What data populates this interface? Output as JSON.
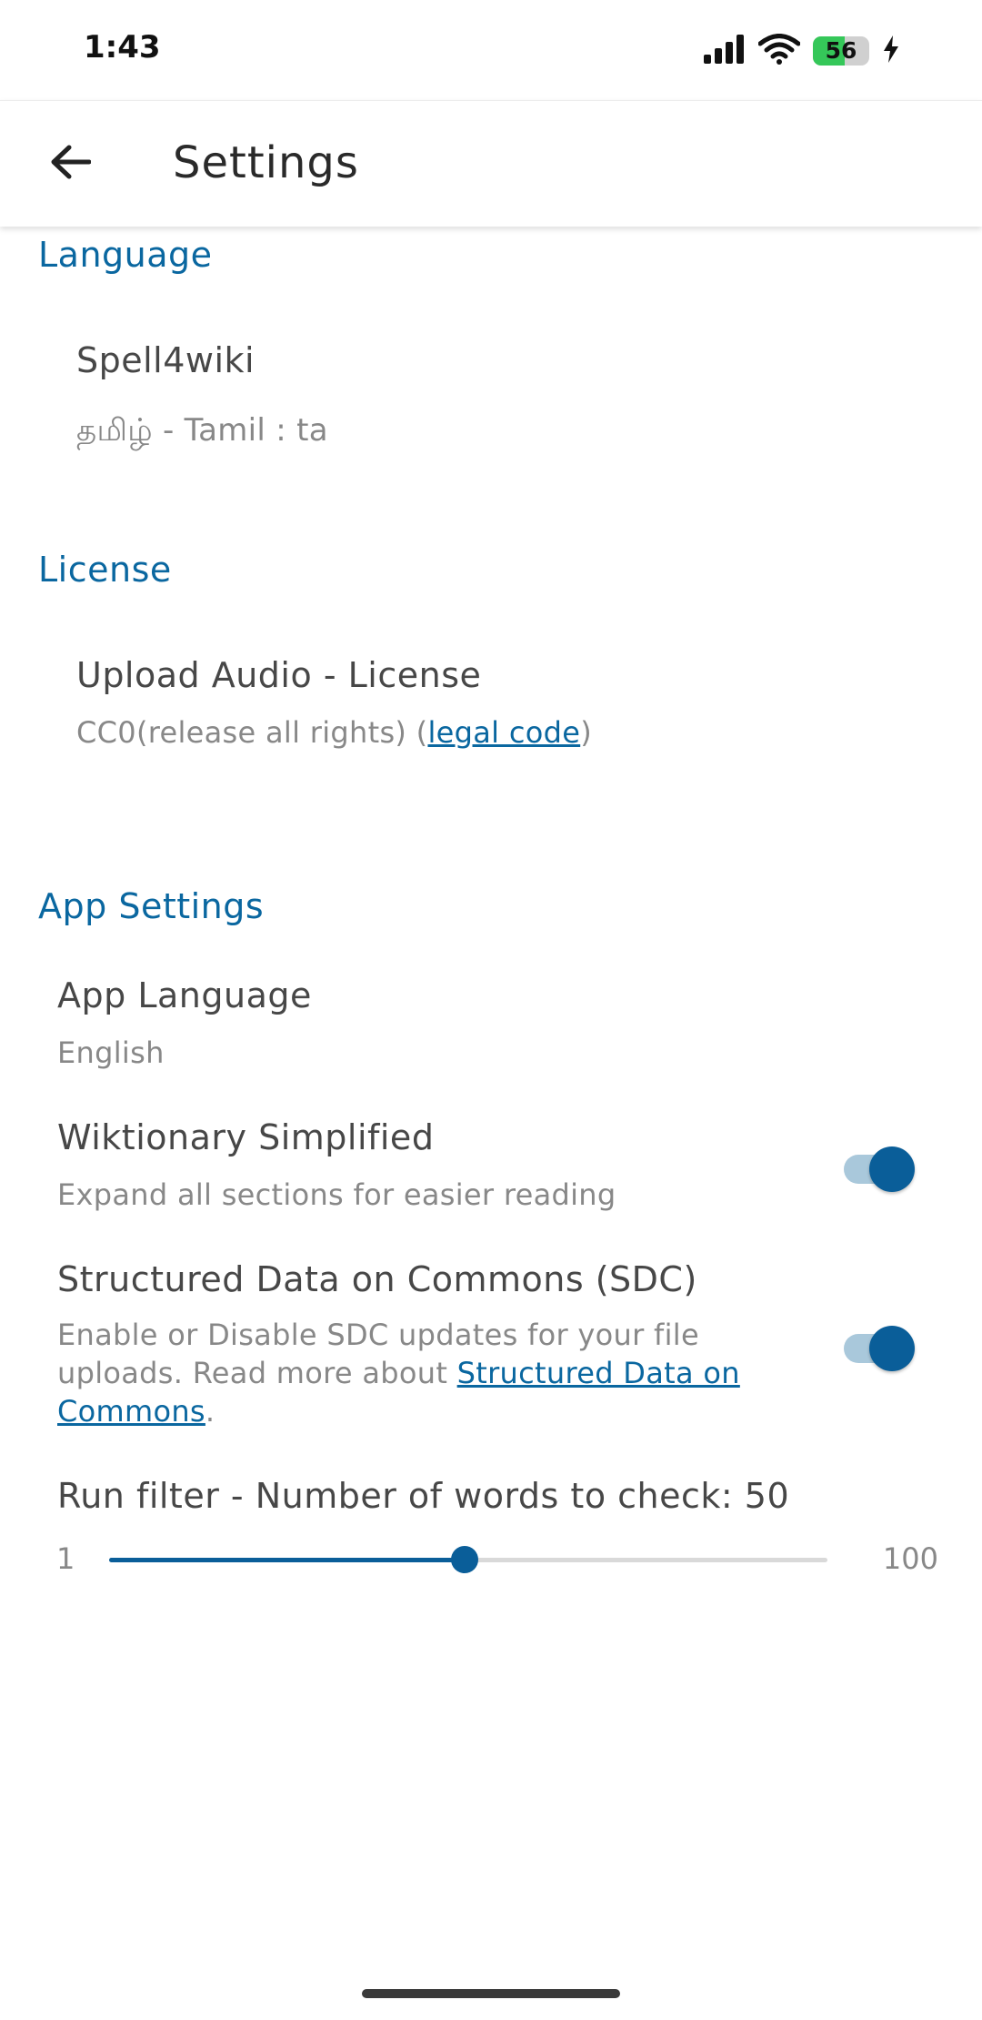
{
  "status_bar": {
    "time": "1:43",
    "battery_level": "56",
    "battery_fraction": 0.56
  },
  "app_bar": {
    "title": "Settings"
  },
  "language_section": {
    "header": "Language",
    "spell4wiki_title": "Spell4wiki",
    "spell4wiki_summary": "தமிழ் - Tamil : ta"
  },
  "license_section": {
    "header": "License",
    "upload_title": "Upload Audio - License",
    "upload_summary_prefix": "CC0(release all rights) (",
    "upload_summary_link": "legal code",
    "upload_summary_suffix": ")"
  },
  "app_settings_section": {
    "header": "App Settings",
    "app_language_title": "App Language",
    "app_language_value": "English",
    "wiktionary_title": "Wiktionary Simplified",
    "wiktionary_summary": "Expand all sections for easier reading",
    "wiktionary_enabled": true,
    "sdc_title": "Structured Data on Commons (SDC)",
    "sdc_summary_prefix": "Enable or Disable SDC updates for your file uploads. Read more about ",
    "sdc_summary_link": "Structured Data on Commons",
    "sdc_summary_suffix": ".",
    "sdc_enabled": true,
    "run_filter_title": "Run filter - Number of words to check: 50",
    "run_filter_min": "1",
    "run_filter_max": "100",
    "run_filter_value": 50
  },
  "colors": {
    "accent": "#0a67a0",
    "switch_thumb": "#0a5e99",
    "switch_track": "#a9c8db"
  }
}
